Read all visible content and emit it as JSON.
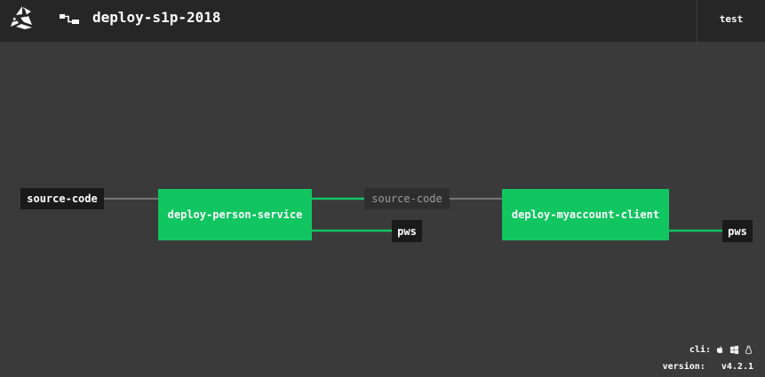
{
  "header": {
    "pipeline_name": "deploy-s1p-2018",
    "team": "test"
  },
  "pipeline": {
    "resources": {
      "source_code_in": "source-code",
      "source_code_passed": "source-code",
      "pws_out_1": "pws",
      "pws_out_2": "pws"
    },
    "jobs": {
      "job1": {
        "name": "deploy-person-service",
        "status": "succeeded"
      },
      "job2": {
        "name": "deploy-myaccount-client",
        "status": "succeeded"
      }
    }
  },
  "footer": {
    "cli_label": "cli:",
    "cli_icons": [
      "apple-icon",
      "windows-icon",
      "linux-icon"
    ],
    "version_label": "version:",
    "version_value": "v4.2.1"
  },
  "colors": {
    "background": "#3a3a3a",
    "topbar": "#262626",
    "job_succeeded": "#11c560",
    "resource": "#1a1a1a",
    "edge_gray": "#777777",
    "edge_green": "#11c560"
  }
}
